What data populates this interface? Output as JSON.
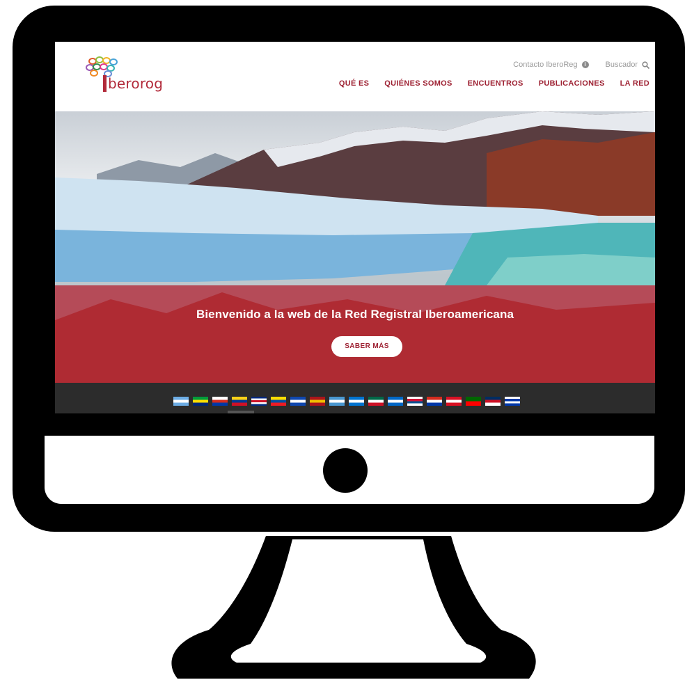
{
  "site": {
    "logo_text": "berorog",
    "utility": {
      "contact": "Contacto IberoReg",
      "search": "Buscador"
    },
    "nav": [
      "QUÉ ES",
      "QUIÉNES SOMOS",
      "ENCUENTROS",
      "PUBLICACIONES",
      "LA RED"
    ]
  },
  "hero": {
    "title": "Bienvenido a la web de la Red Registral Iberoamericana",
    "button_label": "SABER MÁS"
  },
  "flags": [
    {
      "name": "argentina",
      "colors": [
        "#6cace4",
        "#ffffff",
        "#6cace4"
      ]
    },
    {
      "name": "brazil",
      "colors": [
        "#009c3b",
        "#ffdf00",
        "#002776"
      ]
    },
    {
      "name": "chile",
      "colors": [
        "#ffffff",
        "#d52b1e",
        "#0039a6"
      ]
    },
    {
      "name": "colombia",
      "colors": [
        "#fcd116",
        "#003893",
        "#ce1126"
      ]
    },
    {
      "name": "costa-rica",
      "colors": [
        "#002b7f",
        "#ffffff",
        "#ce1126",
        "#ffffff",
        "#002b7f"
      ]
    },
    {
      "name": "ecuador",
      "colors": [
        "#ffdd00",
        "#034ea2",
        "#ed1c24"
      ]
    },
    {
      "name": "el-salvador",
      "colors": [
        "#0f47af",
        "#ffffff",
        "#0f47af"
      ]
    },
    {
      "name": "spain",
      "colors": [
        "#aa151b",
        "#f1bf00",
        "#aa151b"
      ]
    },
    {
      "name": "guatemala",
      "colors": [
        "#4997d0",
        "#ffffff",
        "#4997d0"
      ]
    },
    {
      "name": "honduras",
      "colors": [
        "#0073cf",
        "#ffffff",
        "#0073cf"
      ]
    },
    {
      "name": "mexico",
      "colors": [
        "#006847",
        "#ffffff",
        "#ce1126"
      ]
    },
    {
      "name": "nicaragua",
      "colors": [
        "#0067c6",
        "#ffffff",
        "#0067c6"
      ]
    },
    {
      "name": "panama",
      "colors": [
        "#ffffff",
        "#d21034",
        "#005293",
        "#ffffff"
      ]
    },
    {
      "name": "paraguay",
      "colors": [
        "#d52b1e",
        "#ffffff",
        "#0038a8"
      ]
    },
    {
      "name": "peru",
      "colors": [
        "#d91023",
        "#ffffff",
        "#d91023"
      ]
    },
    {
      "name": "portugal",
      "colors": [
        "#006600",
        "#ff0000"
      ]
    },
    {
      "name": "dominican-republic",
      "colors": [
        "#002d62",
        "#ce1126",
        "#ffffff"
      ]
    },
    {
      "name": "uruguay",
      "colors": [
        "#ffffff",
        "#0038a8",
        "#ffffff",
        "#0038a8"
      ]
    }
  ]
}
